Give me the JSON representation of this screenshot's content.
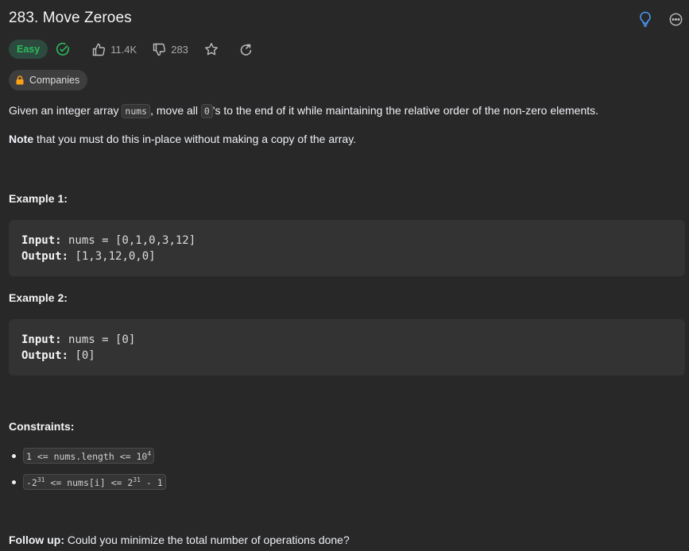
{
  "problem": {
    "title": "283. Move Zeroes",
    "difficulty": "Easy",
    "likes": "11.4K",
    "dislikes": "283",
    "companies_label": "Companies"
  },
  "description": {
    "part1": "Given an integer array ",
    "code1": "nums",
    "part2": ", move all ",
    "code2": "0",
    "part3": "'s to the end of it while maintaining the relative order of the non-zero elements."
  },
  "note": {
    "bold": "Note",
    "text": " that you must do this in-place without making a copy of the array."
  },
  "examples": [
    {
      "heading": "Example 1:",
      "input_label": "Input:",
      "input_value": " nums = [0,1,0,3,12]",
      "output_label": "Output:",
      "output_value": " [1,3,12,0,0]"
    },
    {
      "heading": "Example 2:",
      "input_label": "Input:",
      "input_value": " nums = [0]",
      "output_label": "Output:",
      "output_value": " [0]"
    }
  ],
  "constraints": {
    "heading": "Constraints:",
    "c1_pre": "1 <= nums.length <= 10",
    "c1_sup": "4",
    "c2_a": "-2",
    "c2_sup1": "31",
    "c2_b": " <= nums[i] <= 2",
    "c2_sup2": "31",
    "c2_c": " - 1"
  },
  "followup": {
    "bold": "Follow up:",
    "text": " Could you minimize the total number of operations done?"
  },
  "colors": {
    "background": "#282828",
    "easy": "#2cbb5d",
    "hint": "#4a9eff",
    "code_bg": "#333333"
  },
  "icons": {
    "solved": "check-circle-icon",
    "like": "thumbs-up-icon",
    "dislike": "thumbs-down-icon",
    "favorite": "star-icon",
    "share": "share-icon",
    "hint": "lightbulb-icon",
    "more": "more-icon",
    "lock": "lock-icon"
  }
}
